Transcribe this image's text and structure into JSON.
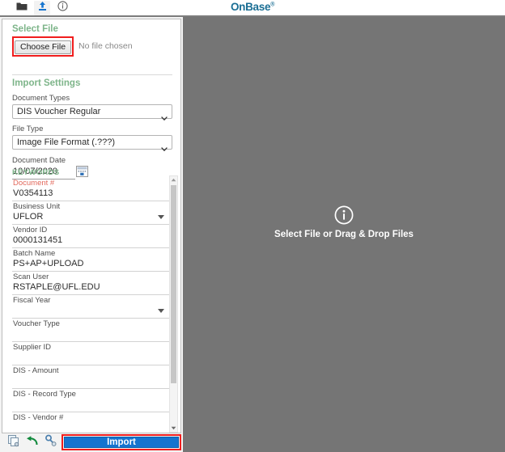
{
  "window": {
    "logo": "OnBase",
    "logo_tm": "®"
  },
  "toolbar": {
    "items": [
      {
        "name": "folder-icon",
        "label": "Folder"
      },
      {
        "name": "upload-icon",
        "label": "Upload",
        "selected": true
      },
      {
        "name": "info-icon",
        "label": "Info"
      }
    ]
  },
  "select_file": {
    "heading": "Select File",
    "choose_button": "Choose File",
    "status": "No file chosen"
  },
  "import_settings": {
    "heading": "Import Settings",
    "document_types": {
      "label": "Document Types",
      "value": "DIS Voucher Regular"
    },
    "file_type": {
      "label": "File Type",
      "value": "Image File Format (.???)"
    },
    "document_date": {
      "label": "Document Date",
      "value": "10/07/2020"
    }
  },
  "keywords": {
    "heading": "KEYWORDS",
    "fields": [
      {
        "label": "Document #",
        "value": "V0354113",
        "required": true,
        "dropdown": false
      },
      {
        "label": "Business Unit",
        "value": "UFLOR",
        "required": false,
        "dropdown": true
      },
      {
        "label": "Vendor ID",
        "value": "0000131451",
        "required": false,
        "dropdown": false
      },
      {
        "label": "Batch Name",
        "value": "PS+AP+UPLOAD",
        "required": false,
        "dropdown": false
      },
      {
        "label": "Scan User",
        "value": "RSTAPLE@UFL.EDU",
        "required": false,
        "dropdown": false
      },
      {
        "label": "Fiscal Year",
        "value": "",
        "required": false,
        "dropdown": true
      },
      {
        "label": "Voucher Type",
        "value": "",
        "required": false,
        "dropdown": false
      },
      {
        "label": "Supplier ID",
        "value": "",
        "required": false,
        "dropdown": false
      },
      {
        "label": "DIS - Amount",
        "value": "",
        "required": false,
        "dropdown": false
      },
      {
        "label": "DIS - Record Type",
        "value": "",
        "required": false,
        "dropdown": false
      },
      {
        "label": "DIS - Vendor #",
        "value": "",
        "required": false,
        "dropdown": false
      }
    ]
  },
  "bottom_bar": {
    "icons": [
      {
        "name": "copy-keywords-icon",
        "label": "Copy Keywords"
      },
      {
        "name": "undo-icon",
        "label": "Undo"
      },
      {
        "name": "keyset-icon",
        "label": "Keyword Set"
      }
    ],
    "import_label": "Import"
  },
  "viewer": {
    "message": "Select File or Drag & Drop Files",
    "icon": "info-circle-icon"
  },
  "colors": {
    "accent_blue": "#1574cf",
    "highlight_red": "#f01e1e",
    "heading_green": "#7eb58a",
    "required_red": "#e2685b",
    "viewer_gray": "#757575",
    "logo_teal": "#1a6e94"
  }
}
